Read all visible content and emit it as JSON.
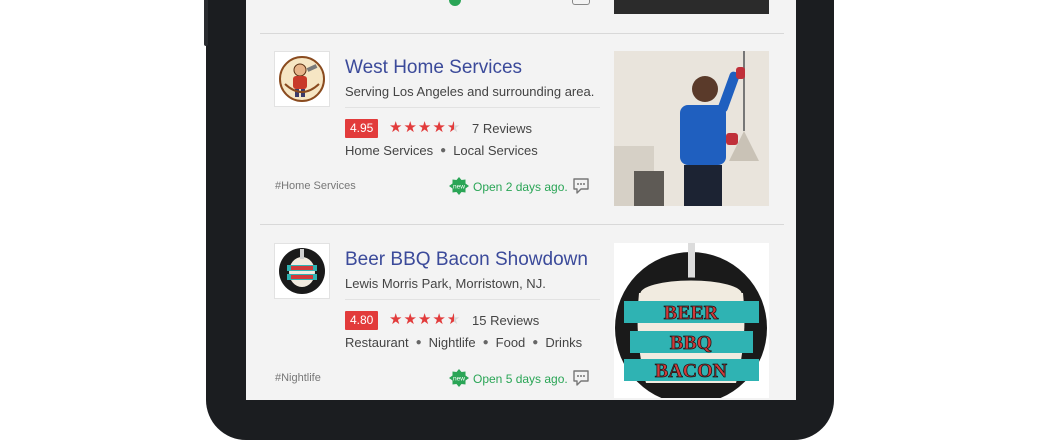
{
  "listings": [
    {
      "title": "West Home Services",
      "subtitle": "Serving Los Angeles and surrounding area.",
      "rating": "4.95",
      "stars": 4.5,
      "reviews": "7 Reviews",
      "categories": [
        "Home Services",
        "Local Services"
      ],
      "hashtag": "#Home Services",
      "badge": "new",
      "opened": "Open 2 days ago."
    },
    {
      "title": "Beer BBQ Bacon Showdown",
      "subtitle": "Lewis Morris Park, Morristown, NJ.",
      "rating": "4.80",
      "stars": 4.5,
      "reviews": "15 Reviews",
      "categories": [
        "Restaurant",
        "Nightlife",
        "Food",
        "Drinks"
      ],
      "hashtag": "#Nightlife",
      "badge": "new",
      "opened": "Open 5 days ago.",
      "logo_text": [
        "BEER",
        "BBQ",
        "BACON"
      ]
    }
  ],
  "icons": [
    "new-badge-icon",
    "comment-icon",
    "star-icon"
  ],
  "colors": {
    "title": "#3b4a9a",
    "rating_badge": "#e23b3b",
    "open_text": "#2aa556",
    "screen_bg": "#f3f3f3"
  }
}
